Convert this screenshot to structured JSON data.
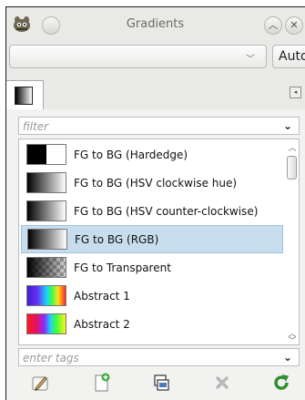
{
  "window": {
    "title": "Gradients"
  },
  "toolbar_top": {
    "combo_value": "",
    "auto_label": "Auto"
  },
  "filter": {
    "placeholder": "filter"
  },
  "tags": {
    "placeholder": "enter tags"
  },
  "gradients": [
    {
      "label": "FG to BG (Hardedge)",
      "swatch": "hardedge"
    },
    {
      "label": "FG to BG (HSV clockwise hue)",
      "swatch": "bw"
    },
    {
      "label": "FG to BG (HSV counter-clockwise)",
      "swatch": "bw"
    },
    {
      "label": "FG to BG (RGB)",
      "swatch": "bw",
      "selected": true
    },
    {
      "label": "FG to Transparent",
      "swatch": "transparent"
    },
    {
      "label": "Abstract 1",
      "swatch": "abstract1"
    },
    {
      "label": "Abstract 2",
      "swatch": "abstract2"
    }
  ],
  "colors": {
    "selection": "#c8deef",
    "new_icon_green": "#3aa93a",
    "refresh_green": "#2f8f2f",
    "delete_gray": "#b8b8b8"
  },
  "icons": [
    "gimp-app-icon",
    "edit-pencil-icon",
    "new-document-icon",
    "duplicate-icon",
    "delete-icon",
    "refresh-icon"
  ]
}
